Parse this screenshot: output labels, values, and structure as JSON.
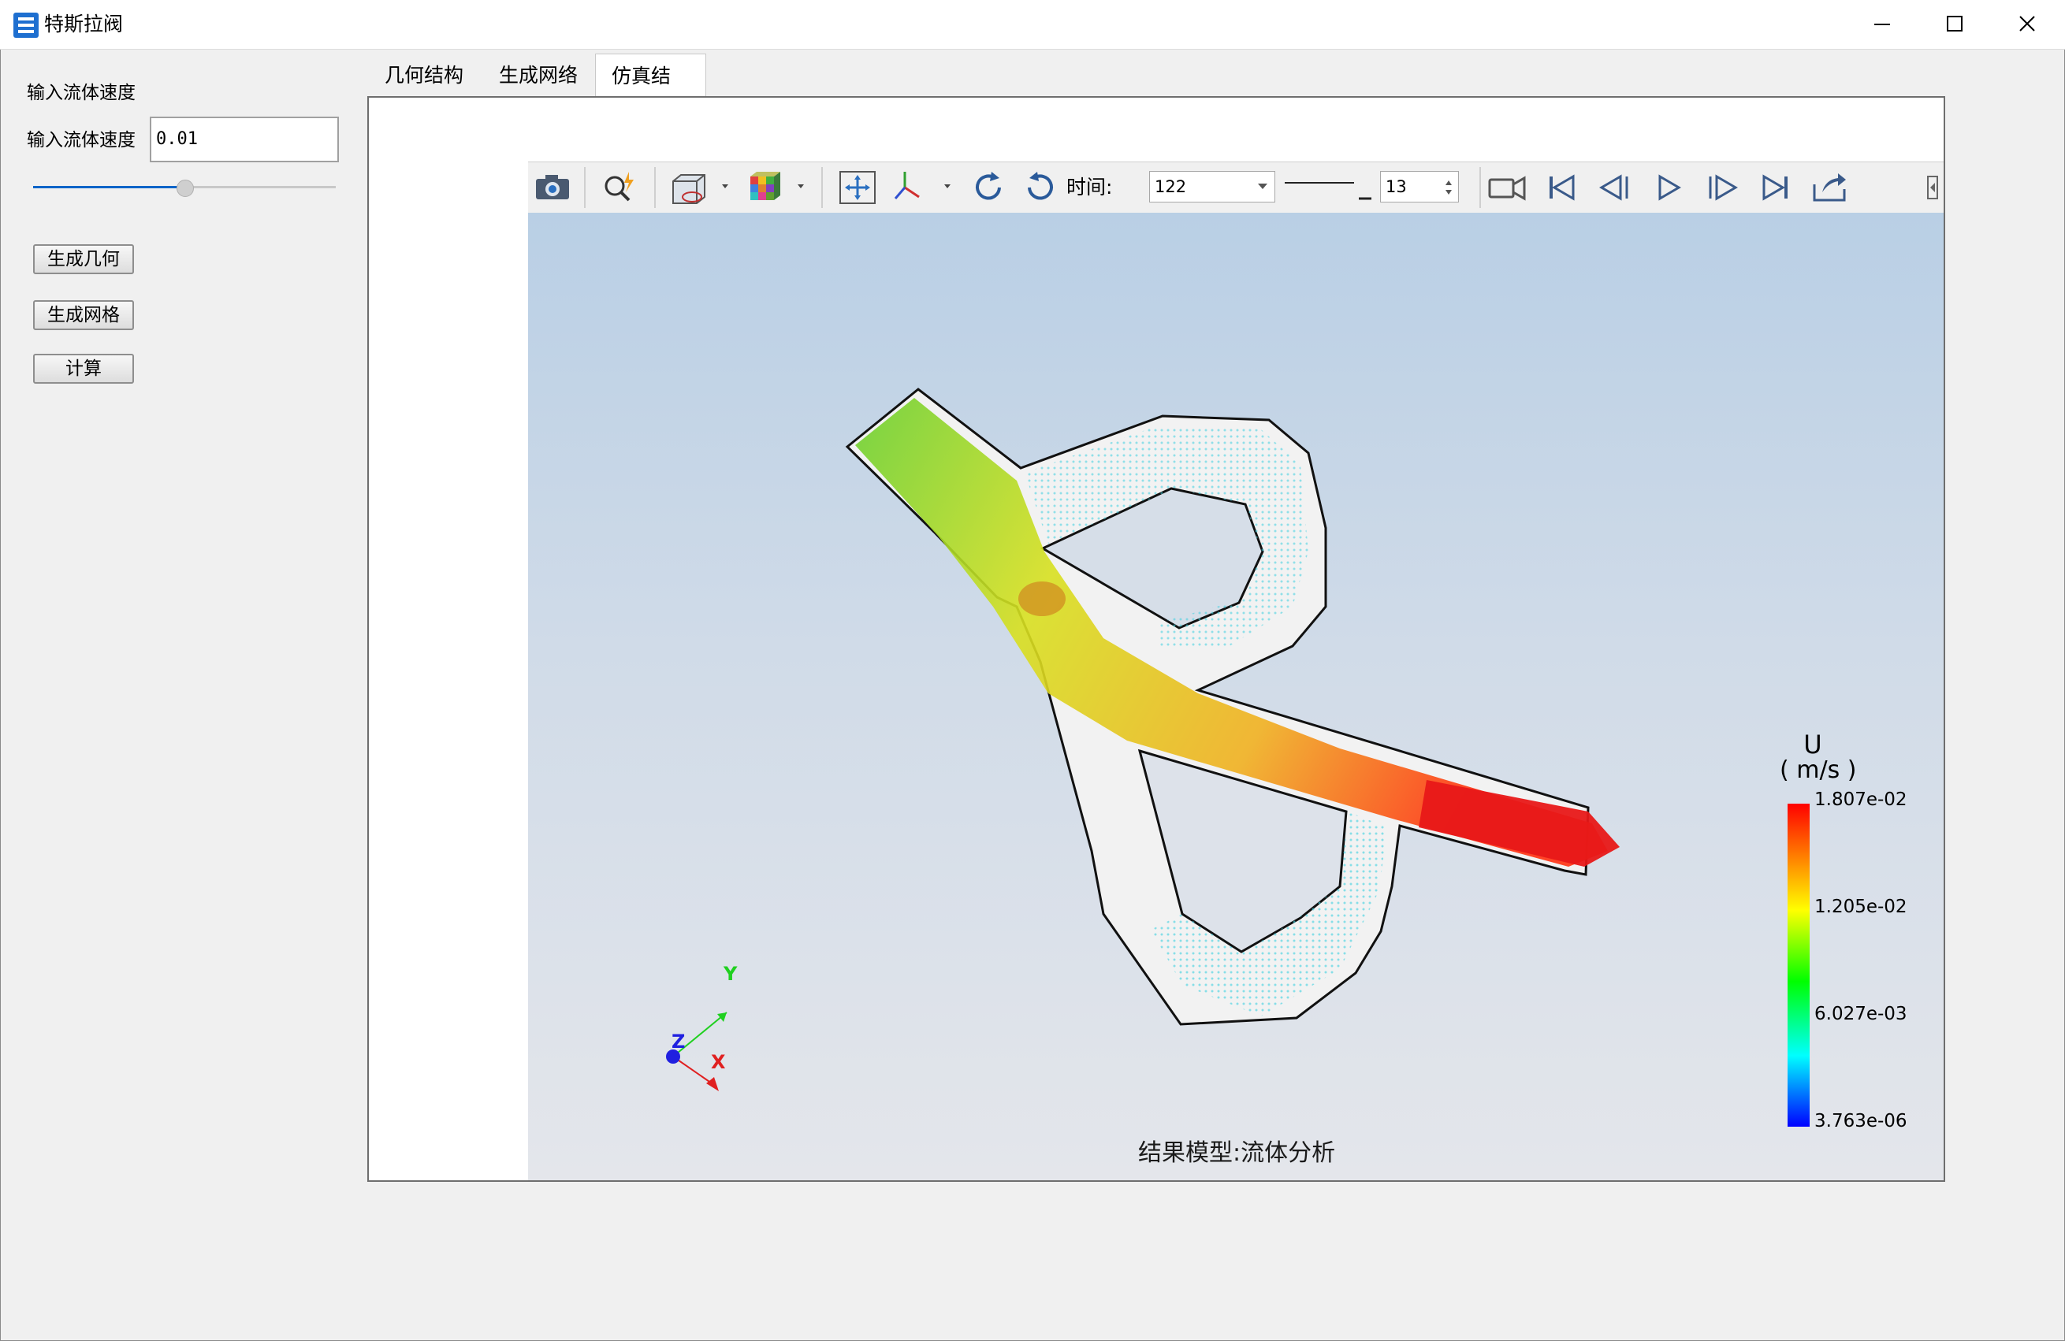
{
  "window": {
    "title": "特斯拉阀"
  },
  "left_panel": {
    "section_title": "输入流体速度",
    "speed_label": "输入流体速度",
    "speed_value": "0.01",
    "slider_level": 0.5,
    "buttons": {
      "geometry": "生成几何",
      "mesh": "生成网格",
      "compute": "计算"
    }
  },
  "tabs": [
    {
      "label": "几何结构",
      "active": false
    },
    {
      "label": "生成网络",
      "active": false
    },
    {
      "label": "仿真结果",
      "active": true
    }
  ],
  "toolbar": {
    "icons": [
      "camera-icon",
      "zoom-icon",
      "view-box-icon",
      "color-cube-icon",
      "fit-view-icon",
      "axes-icon",
      "rotate-icon",
      "reset-view-icon",
      "record-icon",
      "first-frame-icon",
      "prev-frame-icon",
      "play-icon",
      "next-frame-icon",
      "last-frame-icon",
      "export-icon"
    ],
    "time_label": "时间:",
    "time_value": "122",
    "step_value": "13"
  },
  "viewer": {
    "caption": "结果模型:流体分析",
    "axes": {
      "x": "X",
      "y": "Y",
      "z": "Z"
    },
    "legend": {
      "title": "U",
      "unit": "( m/s )",
      "ticks": [
        "1.807e-02",
        "1.205e-02",
        "6.027e-03",
        "3.763e-06"
      ]
    }
  },
  "colors": {
    "accent": "#0a64c8",
    "legend_max": "#ff0000",
    "legend_min": "#0000ff"
  }
}
